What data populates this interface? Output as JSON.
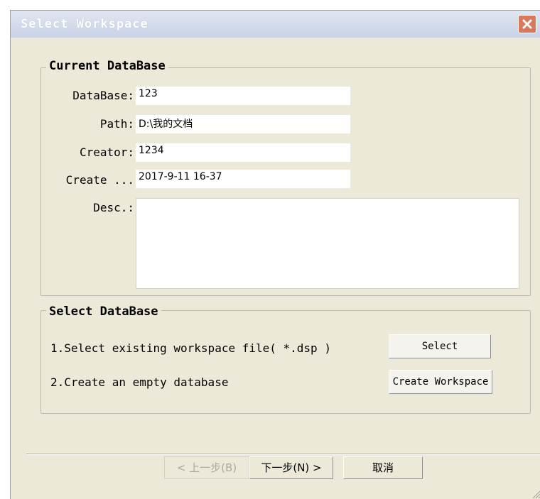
{
  "window": {
    "title": "Select Workspace"
  },
  "current_db": {
    "legend": "Current DataBase",
    "fields": [
      {
        "label": "DataBase:",
        "value": "123"
      },
      {
        "label": "Path:",
        "value": "D:\\我的文档"
      },
      {
        "label": "Creator:",
        "value": "1234"
      },
      {
        "label": "Create ...",
        "value": "2017-9-11  16-37"
      }
    ],
    "desc_label": "Desc.:",
    "desc_value": ""
  },
  "select_db": {
    "legend": "Select DataBase",
    "option1": "1.Select existing workspace file( *.dsp )",
    "option1_button": "Select",
    "option2": "2.Create an empty database",
    "option2_button": "Create Workspace"
  },
  "footer": {
    "back_label": "< 上一步(B)",
    "next_label": "下一步(N) >",
    "cancel_label": "取消"
  },
  "colors": {
    "window_bg": "#ece9d8",
    "titlebar": "#c9d3e6",
    "close": "#d9795c"
  },
  "icons": {
    "close": "close-icon",
    "grip": "resize-grip-icon"
  }
}
